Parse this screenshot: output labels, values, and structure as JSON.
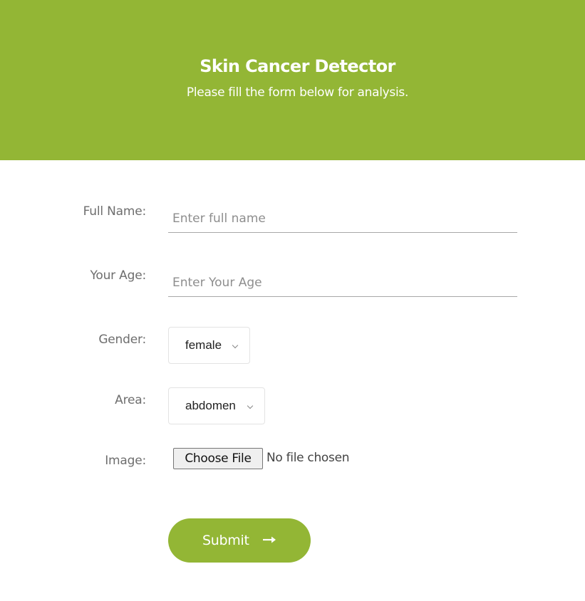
{
  "header": {
    "title": "Skin Cancer Detector",
    "subtitle": "Please fill the form below for analysis.",
    "background_color": "#93b635"
  },
  "form": {
    "full_name": {
      "label": "Full Name:",
      "placeholder": "Enter full name",
      "value": ""
    },
    "age": {
      "label": "Your Age:",
      "placeholder": "Enter Your Age",
      "value": ""
    },
    "gender": {
      "label": "Gender:",
      "selected": "female"
    },
    "area": {
      "label": "Area:",
      "selected": "abdomen"
    },
    "image": {
      "label": "Image:",
      "button_label": "Choose File",
      "status": "No file chosen"
    },
    "submit": {
      "label": "Submit",
      "icon": "arrow-right-icon",
      "color": "#93b635"
    }
  }
}
